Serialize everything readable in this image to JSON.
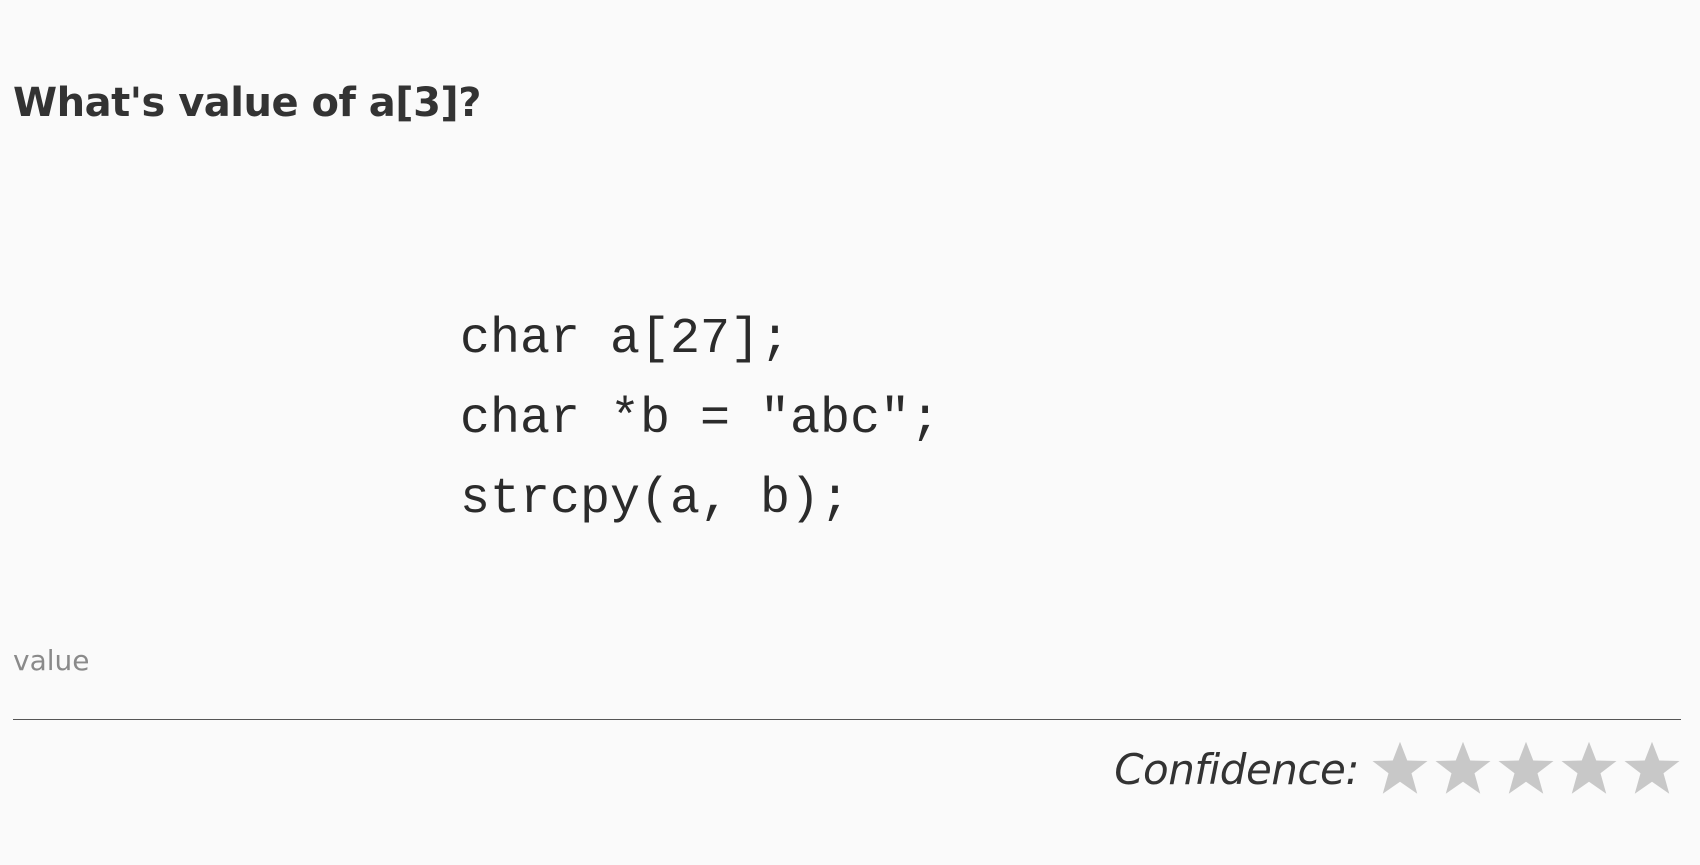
{
  "question": {
    "title": "What's value of a[3]?"
  },
  "code": {
    "lines": [
      "char a[27];",
      "char *b = \"abc\";",
      "strcpy(a, b);"
    ]
  },
  "answer": {
    "value": "",
    "placeholder": "value"
  },
  "confidence": {
    "label": "Confidence:",
    "rating": 0,
    "max": 5,
    "star_color_empty": "#c8c8c8"
  }
}
